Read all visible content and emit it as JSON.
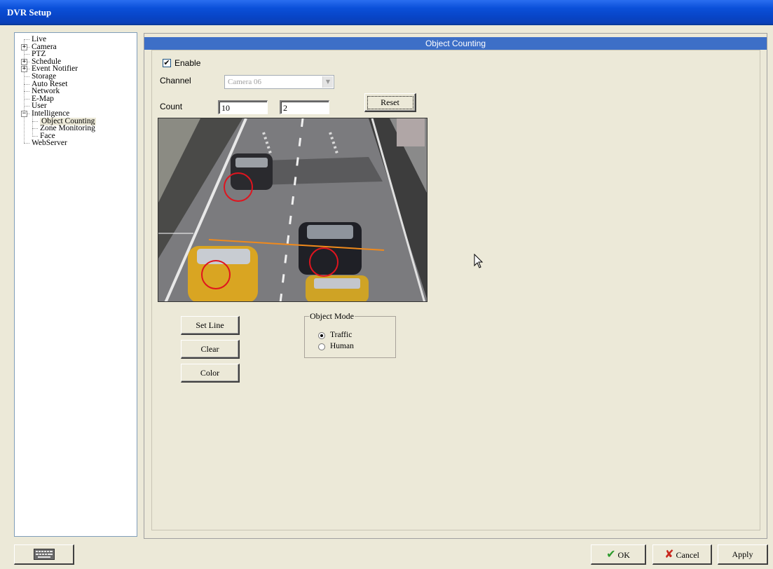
{
  "window": {
    "title": "DVR Setup"
  },
  "tree": {
    "items": [
      {
        "label": "Live",
        "level": 0,
        "expander": ""
      },
      {
        "label": "Camera",
        "level": 0,
        "expander": "+"
      },
      {
        "label": "PTZ",
        "level": 0,
        "expander": ""
      },
      {
        "label": "Schedule",
        "level": 0,
        "expander": "+"
      },
      {
        "label": "Event Notifier",
        "level": 0,
        "expander": "+"
      },
      {
        "label": "Storage",
        "level": 0,
        "expander": ""
      },
      {
        "label": "Auto Reset",
        "level": 0,
        "expander": ""
      },
      {
        "label": "Network",
        "level": 0,
        "expander": ""
      },
      {
        "label": "E-Map",
        "level": 0,
        "expander": ""
      },
      {
        "label": "User",
        "level": 0,
        "expander": ""
      },
      {
        "label": "Intelligence",
        "level": 0,
        "expander": "−"
      },
      {
        "label": "Object Counting",
        "level": 1,
        "expander": "",
        "selected": true
      },
      {
        "label": "Zone Monitoring",
        "level": 1,
        "expander": ""
      },
      {
        "label": "Face",
        "level": 1,
        "expander": ""
      },
      {
        "label": "WebServer",
        "level": 0,
        "expander": ""
      }
    ]
  },
  "panel": {
    "header": "Object Counting",
    "enable": {
      "label": "Enable",
      "checked": true,
      "mark": "✔"
    },
    "channel": {
      "label": "Channel",
      "value": "Camera 06",
      "arrow": "▼"
    },
    "count": {
      "label": "Count",
      "value1": "10",
      "value2": "2"
    },
    "reset_button": "Reset",
    "set_line_button": "Set Line",
    "clear_button": "Clear",
    "color_button": "Color",
    "object_mode": {
      "legend": "Object Mode",
      "options": [
        {
          "label": "Traffic",
          "selected": true
        },
        {
          "label": "Human",
          "selected": false
        }
      ]
    }
  },
  "footer": {
    "keyboard_icon": "keyboard-icon",
    "ok_label": "OK",
    "ok_mark": "✔",
    "cancel_label": "Cancel",
    "cancel_mark": "✘",
    "apply_label": "Apply"
  },
  "colors": {
    "title_bar": "#0a4fd8",
    "panel_header": "#3d6fc7",
    "count_line": "#f08a1c",
    "detection_circle": "#e0141e"
  }
}
